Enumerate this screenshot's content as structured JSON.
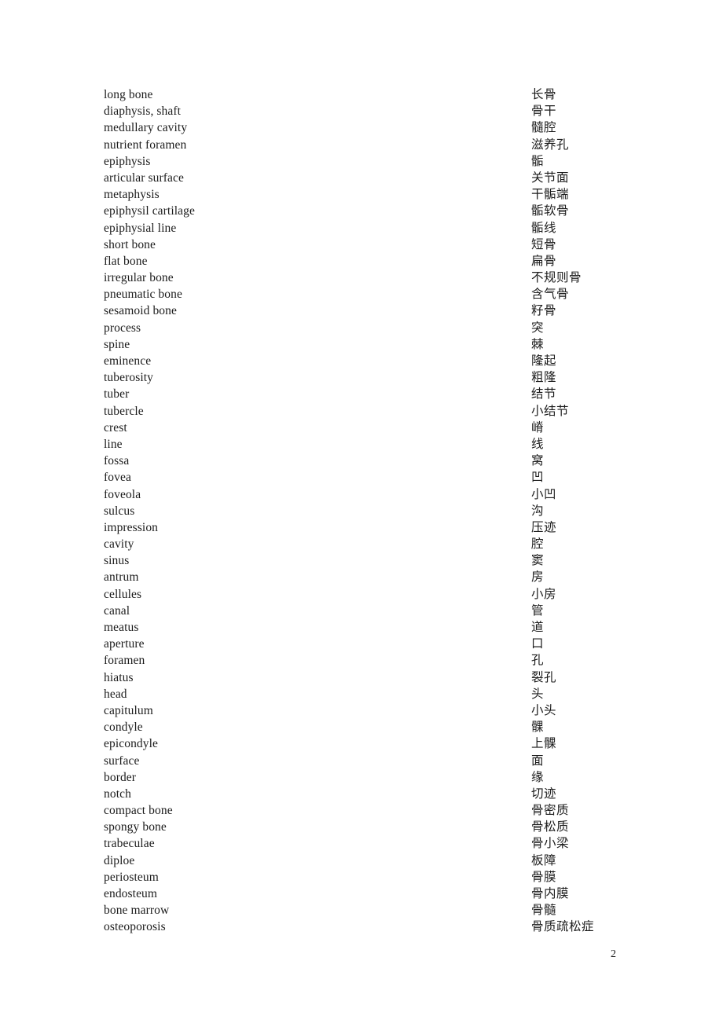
{
  "document": {
    "page_number": "2",
    "columns": {
      "english_header": "",
      "chinese_header": ""
    },
    "terms": [
      {
        "en": "long bone",
        "zh": "长骨"
      },
      {
        "en": "diaphysis, shaft",
        "zh": "骨干"
      },
      {
        "en": "medullary cavity",
        "zh": "髓腔"
      },
      {
        "en": "nutrient foramen",
        "zh": "滋养孔"
      },
      {
        "en": "epiphysis",
        "zh": "骺"
      },
      {
        "en": "articular surface",
        "zh": "关节面"
      },
      {
        "en": "metaphysis",
        "zh": "干骺端"
      },
      {
        "en": "epiphysil cartilage",
        "zh": "骺软骨"
      },
      {
        "en": "epiphysial line",
        "zh": "骺线"
      },
      {
        "en": "short bone",
        "zh": "短骨"
      },
      {
        "en": "flat bone",
        "zh": "扁骨"
      },
      {
        "en": "irregular bone",
        "zh": "不规则骨"
      },
      {
        "en": "pneumatic bone",
        "zh": "含气骨"
      },
      {
        "en": "sesamoid bone",
        "zh": "籽骨"
      },
      {
        "en": "process",
        "zh": "突"
      },
      {
        "en": "spine",
        "zh": "棘"
      },
      {
        "en": "eminence",
        "zh": "隆起"
      },
      {
        "en": "tuberosity",
        "zh": "粗隆"
      },
      {
        "en": "tuber",
        "zh": "结节"
      },
      {
        "en": "tubercle",
        "zh": "小结节"
      },
      {
        "en": "crest",
        "zh": "嵴"
      },
      {
        "en": "line",
        "zh": "线"
      },
      {
        "en": "fossa",
        "zh": "窝"
      },
      {
        "en": "fovea",
        "zh": "凹"
      },
      {
        "en": "foveola",
        "zh": "小凹"
      },
      {
        "en": "sulcus",
        "zh": "沟"
      },
      {
        "en": "impression",
        "zh": "压迹"
      },
      {
        "en": "cavity",
        "zh": "腔"
      },
      {
        "en": "sinus",
        "zh": "窦"
      },
      {
        "en": "antrum",
        "zh": "房"
      },
      {
        "en": "cellules",
        "zh": "小房"
      },
      {
        "en": "canal",
        "zh": "管"
      },
      {
        "en": "meatus",
        "zh": "道"
      },
      {
        "en": "aperture",
        "zh": "口"
      },
      {
        "en": "foramen",
        "zh": "孔"
      },
      {
        "en": "hiatus",
        "zh": "裂孔"
      },
      {
        "en": "head",
        "zh": "头"
      },
      {
        "en": "capitulum",
        "zh": "小头"
      },
      {
        "en": "condyle",
        "zh": "髁"
      },
      {
        "en": "epicondyle",
        "zh": "上髁"
      },
      {
        "en": "surface",
        "zh": "面"
      },
      {
        "en": "border",
        "zh": "缘"
      },
      {
        "en": "notch",
        "zh": "切迹"
      },
      {
        "en": "compact bone",
        "zh": "骨密质"
      },
      {
        "en": "spongy bone",
        "zh": "骨松质"
      },
      {
        "en": "trabeculae",
        "zh": "骨小梁"
      },
      {
        "en": "diploe",
        "zh": "板障"
      },
      {
        "en": "periosteum",
        "zh": "骨膜"
      },
      {
        "en": "endosteum",
        "zh": "骨内膜"
      },
      {
        "en": "bone marrow",
        "zh": "骨髓"
      },
      {
        "en": "osteoporosis",
        "zh": "骨质疏松症"
      }
    ]
  }
}
